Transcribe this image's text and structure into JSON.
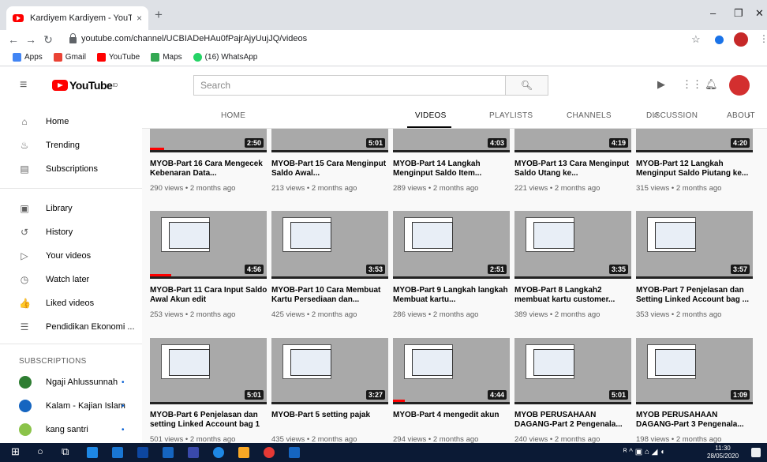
{
  "browser": {
    "tab_title": "Kardiyem Kardiyem - YouTube",
    "tab_close": "×",
    "new_tab": "+",
    "url": "youtube.com/channel/UCBIADeHAu0fPajrAjyUujJQ/videos",
    "win_minimize": "–",
    "win_restore": "❐",
    "win_close": "✕",
    "bookmarks": [
      {
        "label": "Apps",
        "color": "#4285f4"
      },
      {
        "label": "Gmail",
        "color": "#ea4335"
      },
      {
        "label": "YouTube",
        "color": "#ff0000"
      },
      {
        "label": "Maps",
        "color": "#34a853"
      },
      {
        "label": "(16) WhatsApp",
        "color": "#25d366"
      }
    ]
  },
  "youtube": {
    "logo_text": "YouTube",
    "logo_sup": "ID",
    "search_placeholder": "Search",
    "sidebar": [
      {
        "label": "Home",
        "icon": "home-icon",
        "glyph": "⌂"
      },
      {
        "label": "Trending",
        "icon": "trending-icon",
        "glyph": "♨"
      },
      {
        "label": "Subscriptions",
        "icon": "subscriptions-icon",
        "glyph": "▤"
      },
      {
        "label": "Library",
        "icon": "library-icon",
        "glyph": "▣"
      },
      {
        "label": "History",
        "icon": "history-icon",
        "glyph": "↺"
      },
      {
        "label": "Your videos",
        "icon": "your-videos-icon",
        "glyph": "▷"
      },
      {
        "label": "Watch later",
        "icon": "watch-later-icon",
        "glyph": "◷"
      },
      {
        "label": "Liked videos",
        "icon": "liked-videos-icon",
        "glyph": "👍"
      },
      {
        "label": "Pendidikan Ekonomi ...",
        "icon": "playlist-icon",
        "glyph": "☰"
      }
    ],
    "subscriptions_heading": "SUBSCRIPTIONS",
    "subscriptions": [
      {
        "label": "Ngaji Ahlussunnah",
        "color": "#2e7d32"
      },
      {
        "label": "Kalam - Kajian Islam",
        "color": "#1565c0"
      },
      {
        "label": "kang santri",
        "color": "#8bc34a"
      }
    ],
    "channel_tabs": [
      "HOME",
      "VIDEOS",
      "PLAYLISTS",
      "CHANNELS",
      "DISCUSSION",
      "ABOUT"
    ],
    "active_tab": "VIDEOS",
    "videos": [
      {
        "title": "MYOB-Part 16 Cara Mengecek Kebenaran Data...",
        "meta": "290 views • 2 months ago",
        "duration": "2:50",
        "progress": 0.12
      },
      {
        "title": "MYOB-Part 15 Cara Menginput Saldo Awal...",
        "meta": "213 views • 2 months ago",
        "duration": "5:01",
        "progress": 0
      },
      {
        "title": "MYOB-Part 14 Langkah Menginput Saldo Item...",
        "meta": "289 views • 2 months ago",
        "duration": "4:03",
        "progress": 0
      },
      {
        "title": "MYOB-Part 13 Cara Menginput Saldo Utang ke...",
        "meta": "221 views • 2 months ago",
        "duration": "4:19",
        "progress": 0
      },
      {
        "title": "MYOB-Part 12 Langkah Menginput Saldo Piutang ke...",
        "meta": "315 views • 2 months ago",
        "duration": "4:20",
        "progress": 0
      },
      {
        "title": "MYOB-Part 11 Cara Input Saldo Awal Akun edit",
        "meta": "253 views • 2 months ago",
        "duration": "4:56",
        "progress": 0.18
      },
      {
        "title": "MYOB-Part 10 Cara Membuat Kartu Persediaan dan...",
        "meta": "425 views • 2 months ago",
        "duration": "3:53",
        "progress": 0
      },
      {
        "title": "MYOB-Part 9 Langkah langkah Membuat kartu...",
        "meta": "286 views • 2 months ago",
        "duration": "2:51",
        "progress": 0
      },
      {
        "title": "MYOB-Part 8 Langkah2 membuat kartu customer...",
        "meta": "389 views • 2 months ago",
        "duration": "3:35",
        "progress": 0
      },
      {
        "title": "MYOB-Part 7 Penjelasan dan Setting Linked Account bag ...",
        "meta": "353 views • 2 months ago",
        "duration": "3:57",
        "progress": 0
      },
      {
        "title": "MYOB-Part 6 Penjelasan dan setting Linked Account bag 1",
        "meta": "501 views • 2 months ago",
        "duration": "5:01",
        "progress": 0
      },
      {
        "title": "MYOB-Part 5 setting pajak",
        "meta": "435 views • 2 months ago",
        "duration": "3:27",
        "progress": 0
      },
      {
        "title": "MYOB-Part 4 mengedit akun",
        "meta": "294 views • 2 months ago",
        "duration": "4:44",
        "progress": 0.1
      },
      {
        "title": "MYOB PERUSAHAAN DAGANG-Part 2 Pengenala...",
        "meta": "240 views • 2 months ago",
        "duration": "5:01",
        "progress": 0
      },
      {
        "title": "MYOB PERUSAHAAN DAGANG-Part 3 Pengenala...",
        "meta": "198 views • 2 months ago",
        "duration": "1:09",
        "progress": 0
      }
    ]
  },
  "taskbar": {
    "time": "11:30",
    "date": "28/05/2020"
  }
}
